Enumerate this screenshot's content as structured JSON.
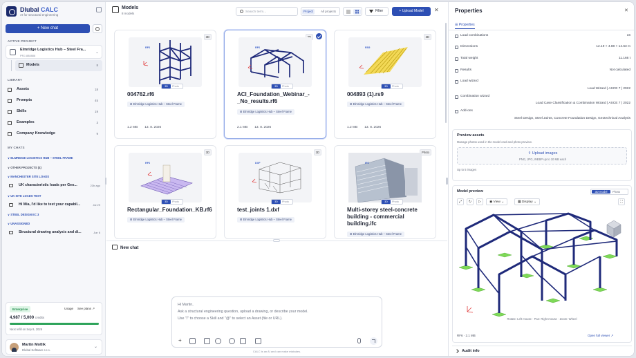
{
  "brand": {
    "name": "Dlubal",
    "product": "CALC",
    "tagline": "AI for structural engineering"
  },
  "sidebar": {
    "new_chat_label": "+ New chat",
    "active_project_heading": "ACTIVE PROJECT",
    "project_name": "Elmridge Logistics Hub – Steel Fra...",
    "project_id": "PRJ-888888",
    "models_label": "Models",
    "models_count": "8",
    "library_heading": "LIBRARY",
    "library": [
      {
        "label": "Assets",
        "count": "18",
        "icon": "assets-icon"
      },
      {
        "label": "Prompts",
        "count": "45",
        "icon": "prompts-icon"
      },
      {
        "label": "Skills",
        "count": "19",
        "icon": "skills-icon"
      },
      {
        "label": "Examples",
        "count": "3",
        "icon": "examples-icon"
      },
      {
        "label": "Company Knowledge",
        "count": "9",
        "icon": "knowledge-icon"
      }
    ],
    "my_chats_heading": "MY CHATS",
    "groups": {
      "g1": "∨ ELMRIDGE LOGISTICS HUB – STEEL FRAME",
      "g2": "∨ OTHER PROJECTS (4)",
      "g3": "∨ MANCHESTER SITE LOADS",
      "g4": "∨ UK SITE LOADS TEST",
      "g5": "∨ STEEL DESIGN EC 3",
      "g6": "∨ UNASSIGNED"
    },
    "chats": [
      {
        "label": "UK characteristic loads per Geo...",
        "date": "23h ago"
      },
      {
        "label": "Hi Mia, I'd like to test your capabil...",
        "date": "Jul 29"
      },
      {
        "label": "Structural drawing analysis and di...",
        "date": "Jun 6"
      }
    ],
    "plan": {
      "badge": "Enterprise",
      "usage": "Usage",
      "see_plans": "See plans ↗",
      "credits": "4,987 / 5,000",
      "credits_unit": "credits",
      "credits_fraction": 0.997,
      "refill": "Next refill on Sep 9, 2026"
    },
    "user": {
      "name": "Martin Motlik",
      "company": "Dlubal Software s.r.o."
    }
  },
  "center": {
    "title": "Models",
    "subtitle": "8 models",
    "search_placeholder": "Search term...",
    "scope_active": "Project",
    "scope_other": "All projects",
    "filter_label": "Filter",
    "upload_label": "+ Upload Model",
    "close": "✕",
    "cards": [
      {
        "name": "004762.rf6",
        "type": "RF6",
        "badge": "3D",
        "tag": "⊞ Elmridge Logistics Hub – Steel Frame",
        "size": "1.2 MB",
        "date": "13. 8. 2026",
        "selected": false
      },
      {
        "name": "ACI_Foundation_Webinar_-_No_results.rf6",
        "type": "RF6",
        "badge": "3D",
        "tag": "⊞ Elmridge Logistics Hub – Steel Frame",
        "size": "2.1 MB",
        "date": "13. 8. 2026",
        "selected": true
      },
      {
        "name": "004893 (1).rs9",
        "type": "RS9",
        "badge": "3D",
        "tag": "⊞ Elmridge Logistics Hub – Steel Frame",
        "size": "1.2 MB",
        "date": "13. 8. 2026",
        "selected": false
      },
      {
        "name": "Rectangular_Foundation_KB.rf6",
        "type": "RF6",
        "badge": "3D",
        "tag": "⊞ Elmridge Logistics Hub – Steel Frame"
      },
      {
        "name": "test_joints 1.dxf",
        "type": "DXF",
        "badge": "3D",
        "tag": "⊞ Elmridge Logistics Hub – Steel Frame"
      },
      {
        "name": "Multi-storey steel-concrete building - commercial building.ifc",
        "type": "IFC",
        "badge": "Photo",
        "tag": "⊞ Elmridge Logistics Hub – Steel Frame"
      }
    ],
    "pill_3d": "3D",
    "pill_photo": "Photo",
    "new_chat_title": "New chat",
    "prompt_lines": [
      "Hi Martin,",
      "Ask a structural engineering question, upload a drawing, or describe your model.",
      "Use \"/\" to choose a Skill and \"@\" to select an Asset (file or URL)."
    ],
    "disclaimer": "CALC is an AI and can make mistakes."
  },
  "right": {
    "title": "Properties",
    "close": "✕",
    "tab": "☰ Properties",
    "props": [
      {
        "k": "Load combinations",
        "v": "16"
      },
      {
        "k": "Dimensions",
        "v": "12.19 × 4.88 × 14.63 m"
      },
      {
        "k": "Total weight",
        "v": "11.166 t"
      },
      {
        "k": "Results",
        "v": "Not calculated"
      },
      {
        "k": "Load wizard",
        "v": ""
      },
      {
        "k": "",
        "v": "Load Wizard | ASCE 7 | 2022"
      },
      {
        "k": "Combination wizard",
        "v": ""
      },
      {
        "k": "",
        "v": "Load Case Classification & Combination Wizard | ASCE 7 | 2022"
      },
      {
        "k": "Add-ons",
        "v": ""
      },
      {
        "k": "",
        "v": "Steel Design, Steel Joints, Concrete Foundation Design, Geotechnical Analysis"
      }
    ],
    "preview_assets": {
      "title": "Preview assets",
      "sub": "Manage photos used in the model card and photo preview.",
      "upload": "⇪ Upload images",
      "formats": "PNG, JPG, WEBP up to 10 MB each",
      "limit": "Up to 5 images"
    },
    "model_preview": {
      "title": "Model preview",
      "toggle_on": "3D model",
      "toggle_off": "Photo",
      "view_label": "View",
      "display_label": "Display",
      "hint": "Rotate: Left mouse · Pan: Right mouse · Zoom: Wheel",
      "file_info": "RF6 · 2.1 MB",
      "open_full": "Open full viewer ↗"
    },
    "audit": "Audit info"
  },
  "colors": {
    "accent": "#2d4fb4",
    "frame": "#1f2a7a",
    "support": "#7ed957",
    "truss_yellow": "#f2d43a"
  }
}
